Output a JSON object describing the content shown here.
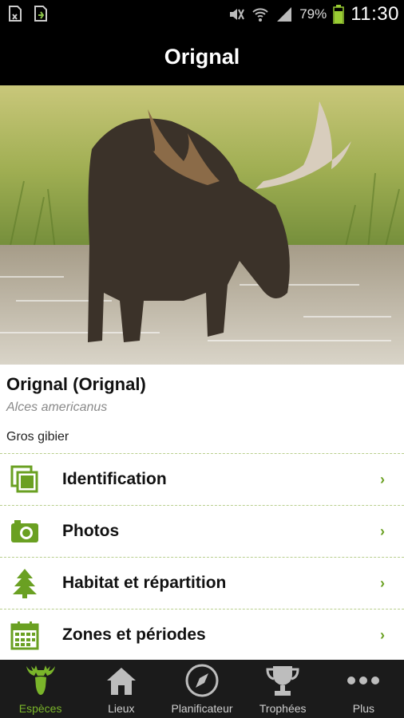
{
  "status_bar": {
    "battery": "79%",
    "time": "11:30",
    "icons": [
      "document-icon",
      "download-icon",
      "mute-icon",
      "wifi-icon",
      "signal-icon",
      "battery-icon"
    ]
  },
  "header": {
    "title": "Orignal"
  },
  "species": {
    "name": "Orignal  (Orignal)",
    "latin": "Alces americanus",
    "category": "Gros gibier"
  },
  "menu": {
    "items": [
      {
        "label": "Identification",
        "icon": "cards-icon"
      },
      {
        "label": "Photos",
        "icon": "camera-icon"
      },
      {
        "label": "Habitat et répartition",
        "icon": "tree-icon"
      },
      {
        "label": "Zones et périodes",
        "icon": "calendar-icon"
      }
    ],
    "chevron": "›"
  },
  "bottom_nav": {
    "items": [
      {
        "label": "Espèces",
        "icon": "moose-icon",
        "active": true
      },
      {
        "label": "Lieux",
        "icon": "home-icon"
      },
      {
        "label": "Planificateur",
        "icon": "compass-icon"
      },
      {
        "label": "Trophées",
        "icon": "trophy-icon"
      },
      {
        "label": "Plus",
        "icon": "more-icon"
      }
    ]
  },
  "colors": {
    "accent": "#6aa022",
    "bar": "#000000",
    "nav_bg": "#1b1b1b"
  }
}
